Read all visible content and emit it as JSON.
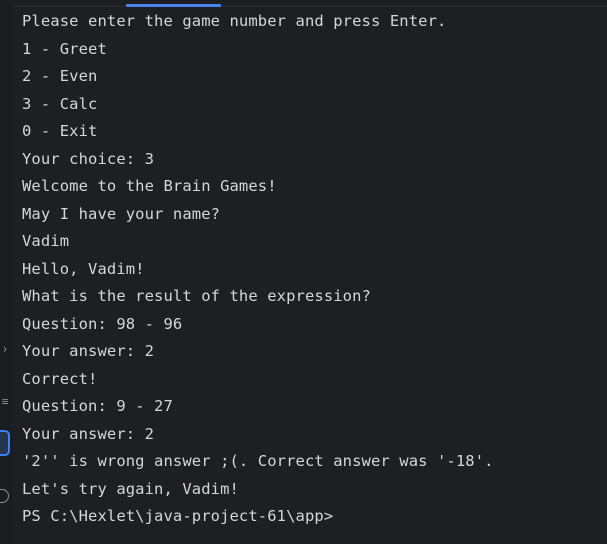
{
  "terminal": {
    "lines": [
      "Please enter the game number and press Enter.",
      "1 - Greet",
      "2 - Even",
      "3 - Calc",
      "0 - Exit",
      "Your choice: 3",
      "Welcome to the Brain Games!",
      "May I have your name?",
      "Vadim",
      "Hello, Vadim!",
      "What is the result of the expression?",
      "Question: 98 - 96",
      "Your answer: 2",
      "Correct!",
      "Question: 9 - 27",
      "Your answer: 2",
      "'2'' is wrong answer ;(. Correct answer was '-18'.",
      "Let's try again, Vadim!",
      "PS C:\\Hexlet\\java-project-61\\app>"
    ]
  },
  "icons": {
    "gutter": [
      "chevron-right-icon",
      "soft-wrap-icon",
      "active-tool-icon",
      "history-icon"
    ]
  },
  "colors": {
    "background": "#1e1f22",
    "text": "#d6d6d8",
    "accent": "#4a83ee"
  }
}
